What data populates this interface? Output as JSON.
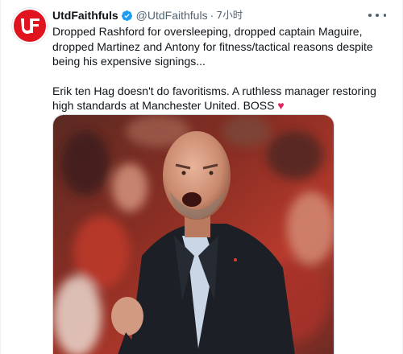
{
  "tweet": {
    "display_name": "UtdFaithfuls",
    "handle": "@UtdFaithfuls",
    "separator": "·",
    "time": "7小时",
    "avatar_text": "UF",
    "paragraph1": "Dropped Rashford for oversleeping, dropped captain Maguire, dropped Martinez and Antony for fitness/tactical reasons despite being his expensive signings...",
    "paragraph2": "Erik ten Hag doesn't do favoritisms. A ruthless manager restoring high standards at Manchester United. BOSS",
    "paragraph2_emoji": "♥"
  },
  "icons": {
    "verified": "verified-badge-icon",
    "more": "more-options-icon"
  },
  "colors": {
    "avatar_bg": "#e0141f",
    "verified": "#1d9bf0",
    "heart": "#e0245e"
  }
}
